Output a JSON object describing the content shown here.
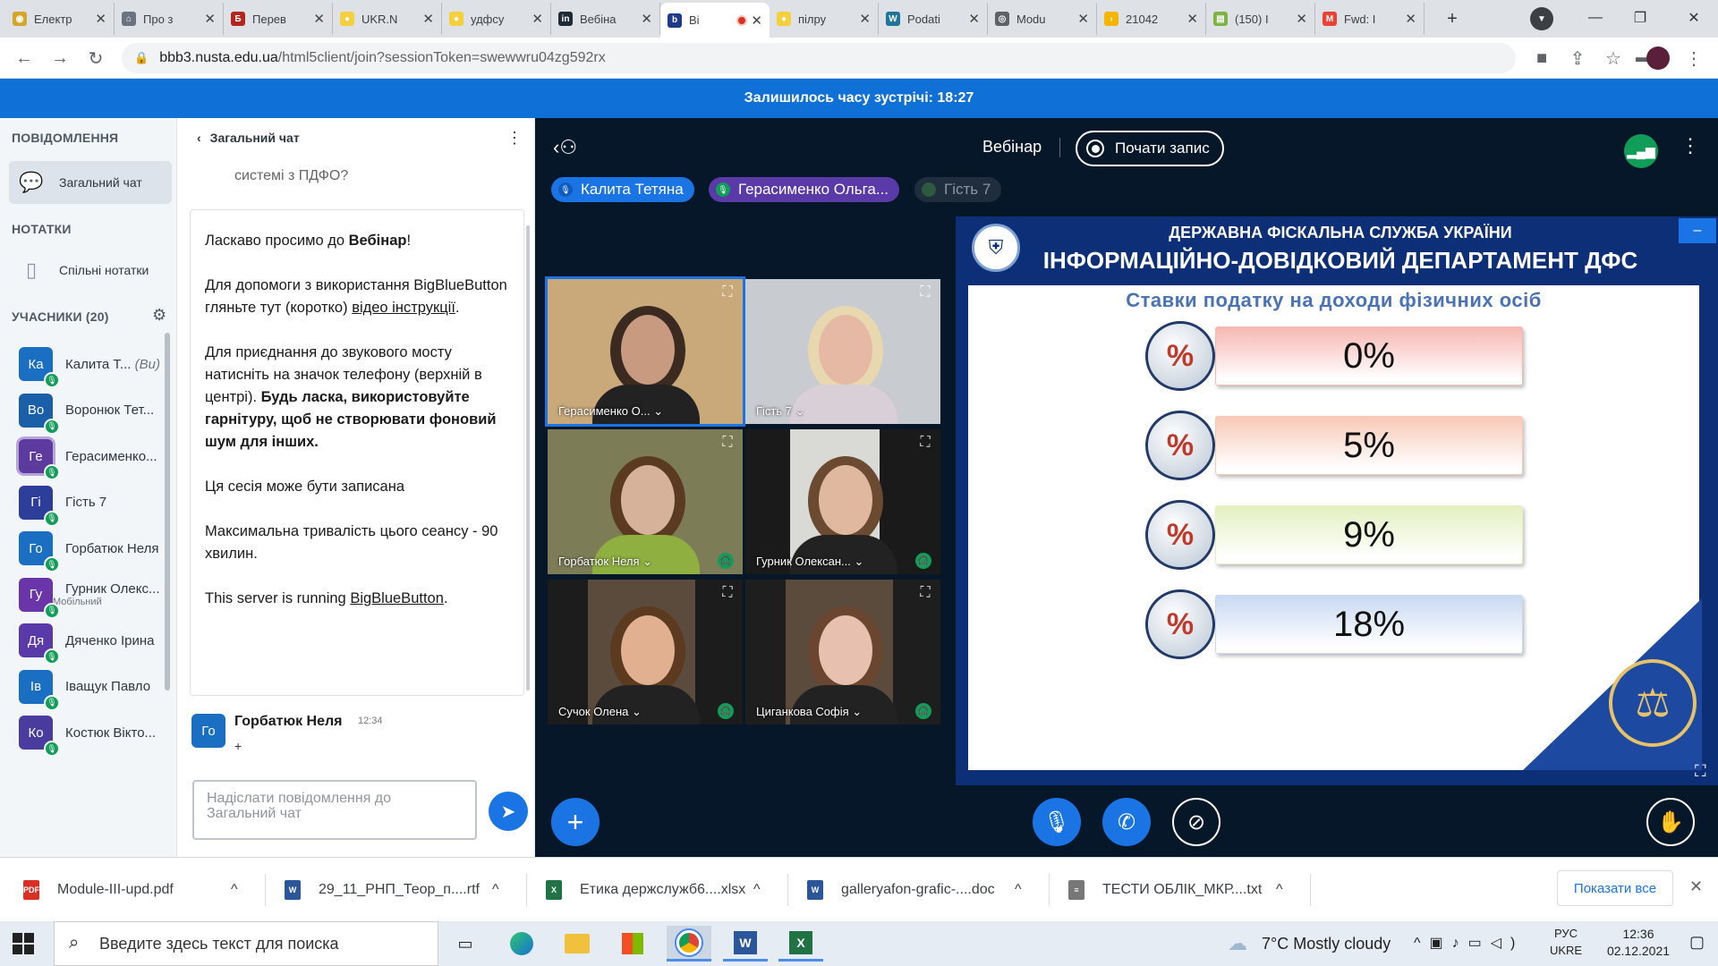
{
  "browser": {
    "tabs": [
      {
        "title": "Електр",
        "color": "#d4a72c",
        "glyph": "◉"
      },
      {
        "title": "Про з",
        "color": "#6b7280",
        "glyph": "⌂"
      },
      {
        "title": "Перев",
        "color": "#b3261e",
        "glyph": "Б"
      },
      {
        "title": "UKR.N",
        "color": "#f4d03f",
        "glyph": "●"
      },
      {
        "title": "удфсу",
        "color": "#f4d03f",
        "glyph": "●"
      },
      {
        "title": "Вебіна",
        "color": "#1e2a38",
        "glyph": "in"
      },
      {
        "title": "Ві",
        "color": "#1e3a8a",
        "glyph": "b",
        "active": true
      },
      {
        "title": "пілру",
        "color": "#f4d03f",
        "glyph": "●"
      },
      {
        "title": "Podati",
        "color": "#21759b",
        "glyph": "W"
      },
      {
        "title": "Modu",
        "color": "#5f6368",
        "glyph": "◎"
      },
      {
        "title": "21042",
        "color": "#f5b400",
        "glyph": "›"
      },
      {
        "title": "(150) I",
        "color": "#7cb342",
        "glyph": "▤"
      },
      {
        "title": "Fwd: I",
        "color": "#ea4335",
        "glyph": "M"
      }
    ],
    "new_tab": "+",
    "url_host": "bbb3.nusta.edu.ua",
    "url_path": "/html5client/join?sessionToken=swewwru04zg592rx"
  },
  "banner": {
    "text": "Залишилось часу зустрічі: 18:27"
  },
  "sidebar": {
    "messages_heading": "ПОВІДОМЛЕННЯ",
    "public_chat": "Загальний чат",
    "notes_heading": "НОТАТКИ",
    "shared_notes": "Спільні нотатки",
    "users_heading": "УЧАСНИКИ (20)",
    "users": [
      {
        "initials": "Ка",
        "name": "Калита Т...",
        "tag": "(Ви)",
        "color": "#1b6fc2"
      },
      {
        "initials": "Во",
        "name": "Воронюк Тет...",
        "color": "#1b5fa8"
      },
      {
        "initials": "Ге",
        "name": "Герасименко...",
        "color": "#5d3a9e"
      },
      {
        "initials": "Гі",
        "name": "Гість 7",
        "color": "#2c3e9a"
      },
      {
        "initials": "Го",
        "name": "Горбатюк Неля",
        "color": "#1b6fc2"
      },
      {
        "initials": "Гу",
        "name": "Гурник Олекс...",
        "sub": "Мобільний",
        "color": "#6a35a8"
      },
      {
        "initials": "Дя",
        "name": "Дяченко Ірина",
        "color": "#5a3aa8"
      },
      {
        "initials": "Ів",
        "name": "Іващук Павло",
        "color": "#1b6fc2"
      },
      {
        "initials": "Ко",
        "name": "Костюк Вікто...",
        "color": "#4a3b9e"
      }
    ]
  },
  "chat": {
    "title": "Загальний чат",
    "prev_text": "системі з ПДФО?",
    "welcome": {
      "p1a": "Ласкаво просимо до ",
      "p1b": "Вебінар",
      "p1c": "!",
      "p2a": "Для допомоги з використання BigBlueButton гляньте тут (коротко) ",
      "p2b": "відео інструкції",
      "p2c": ".",
      "p3a": "Для приєднання до звукового мосту натисніть на значок телефону (верхній в центрі). ",
      "p3b": "Будь ласка, використовуйте гарнітуру, щоб не створювати фоновий шум для інших.",
      "p4": "Ця сесія може бути записана",
      "p5": "Максимальна тривалість цього сеансу - 90 хвилин.",
      "p6a": "This server is running ",
      "p6b": "BigBlueButton",
      "p6c": "."
    },
    "last_message": {
      "initials": "Го",
      "name": "Горбатюк Неля",
      "time": "12:34",
      "text": "+"
    },
    "input_placeholder": "Надіслати повідомлення до Загальний чат"
  },
  "meeting": {
    "title": "Вебінар",
    "record_label": "Почати запис",
    "talkers": [
      "Калита Тетяна",
      "Герасименко Ольга...",
      "Гість 7"
    ],
    "videos": [
      {
        "name": "Герасименко О...",
        "bg": "#c9a97a",
        "skin": "#c89a80",
        "hair": "#3a2a20"
      },
      {
        "name": "Гість 7",
        "bg": "#c8cbd0",
        "skin": "#e6b9a4",
        "hair": "#e8d8b0"
      },
      {
        "name": "Горбатюк Неля",
        "bg": "#7c7d57",
        "skin": "#d6b29a",
        "hair": "#5a3a20"
      },
      {
        "name": "Гурник Олексан...",
        "bg": "#1a1a1a",
        "skin": "#e0b8a0",
        "hair": "#6a4a30"
      },
      {
        "name": "Сучок Олена",
        "bg": "#1c1c1c",
        "skin": "#e0b090",
        "hair": "#5c3a20"
      },
      {
        "name": "Циганкова Софія",
        "bg": "#1e1e1e",
        "skin": "#e8c0b0",
        "hair": "#6a4530"
      }
    ],
    "slide": {
      "org": "ДЕРЖАВНА ФІСКАЛЬНА СЛУЖБА УКРАЇНИ",
      "dept": "ІНФОРМАЦІЙНО-ДОВІДКОВИЙ ДЕПАРТАМЕНТ ДФС",
      "heading": "Ставки податку на доходи фізичних осіб",
      "rates": [
        {
          "value": "0%",
          "color": "#f7b7b2"
        },
        {
          "value": "5%",
          "color": "#f8c9b6"
        },
        {
          "value": "9%",
          "color": "#e3f0c0"
        },
        {
          "value": "18%",
          "color": "#c8d9f2"
        }
      ]
    }
  },
  "downloads": {
    "items": [
      {
        "name": "Module-III-upd.pdf",
        "type": "pdf"
      },
      {
        "name": "29_11_РНП_Теор_п....rtf",
        "type": "word"
      },
      {
        "name": "Етика держслужб6....xlsx",
        "type": "excel"
      },
      {
        "name": "galleryafon-grafic-....doc",
        "type": "word"
      },
      {
        "name": "ТЕСТИ ОБЛІК_МКР....txt",
        "type": "txt"
      }
    ],
    "show_all": "Показати все"
  },
  "taskbar": {
    "search_placeholder": "Введите здесь текст для поиска",
    "weather": "7°C  Mostly cloudy",
    "lang1": "РУС",
    "lang2": "UKRE",
    "time": "12:36",
    "date": "02.12.2021"
  }
}
